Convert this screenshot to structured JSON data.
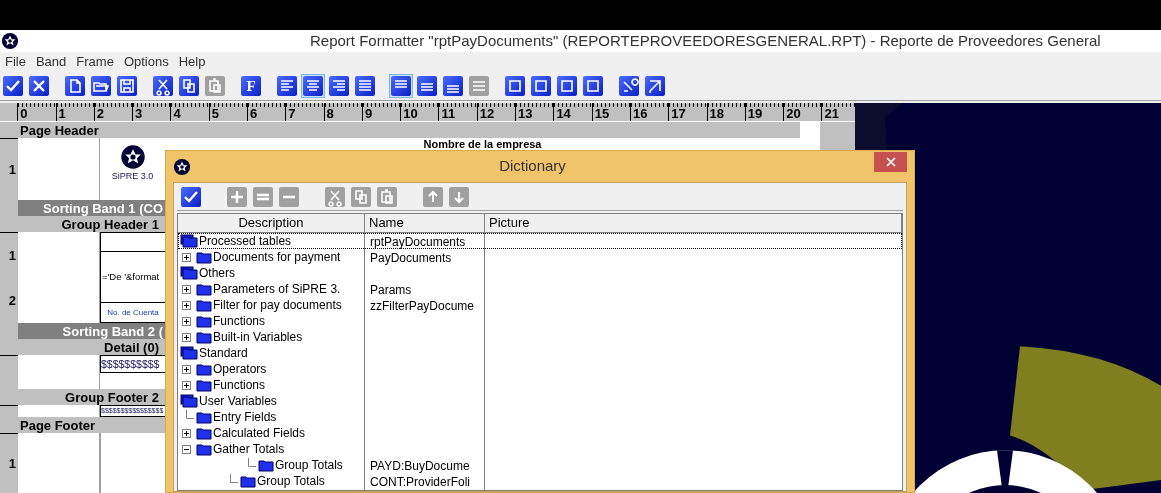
{
  "window": {
    "title": "Report Formatter \"rptPayDocuments\" (REPORTEPROVEEDORESGENERAL.RPT) - Reporte de Proveedores General"
  },
  "menu": [
    "File",
    "Band",
    "Frame",
    "Options",
    "Help"
  ],
  "toolbar": [
    [
      {
        "kind": "check",
        "pressed": false,
        "disabled": false
      },
      {
        "kind": "cross",
        "pressed": false,
        "disabled": false
      }
    ],
    [
      {
        "kind": "new",
        "pressed": false,
        "disabled": false
      },
      {
        "kind": "open",
        "pressed": false,
        "disabled": false
      },
      {
        "kind": "save",
        "pressed": false,
        "disabled": false
      }
    ],
    [
      {
        "kind": "cut",
        "pressed": false,
        "disabled": false
      },
      {
        "kind": "copy",
        "pressed": false,
        "disabled": false
      },
      {
        "kind": "paste",
        "pressed": false,
        "disabled": true
      }
    ],
    [
      {
        "kind": "font",
        "label": "F",
        "pressed": false,
        "disabled": false
      }
    ],
    [
      {
        "kind": "align-left",
        "pressed": false,
        "disabled": false
      },
      {
        "kind": "align-center",
        "pressed": true,
        "disabled": false
      },
      {
        "kind": "align-right",
        "pressed": false,
        "disabled": false
      },
      {
        "kind": "justify",
        "pressed": false,
        "disabled": false
      }
    ],
    [
      {
        "kind": "valign-top",
        "pressed": true,
        "disabled": false
      },
      {
        "kind": "valign-middle",
        "pressed": false,
        "disabled": false
      },
      {
        "kind": "valign-bottom",
        "pressed": false,
        "disabled": false
      },
      {
        "kind": "lines",
        "pressed": false,
        "disabled": true
      }
    ],
    [
      {
        "kind": "frame",
        "pressed": false,
        "disabled": false
      },
      {
        "kind": "frame",
        "pressed": false,
        "disabled": false
      },
      {
        "kind": "frame",
        "pressed": false,
        "disabled": false
      },
      {
        "kind": "frame",
        "pressed": false,
        "disabled": false
      }
    ],
    [
      {
        "kind": "brush",
        "pressed": false,
        "disabled": false
      },
      {
        "kind": "pen",
        "pressed": false,
        "disabled": false
      }
    ]
  ],
  "ruler": [
    "0",
    "1",
    "2",
    "3",
    "4",
    "5",
    "6",
    "7",
    "8",
    "9",
    "10",
    "11",
    "12",
    "13",
    "14",
    "15",
    "16",
    "17",
    "18",
    "19",
    "20",
    "21"
  ],
  "bands": [
    {
      "kind": "page",
      "label": "Page Header",
      "content": {
        "kind": "header",
        "ruler_marks": [
          "1"
        ],
        "logo_caption": "SiPRE 3.0",
        "company": "Nombre de la empresa"
      }
    },
    {
      "kind": "sorting",
      "label": "Sorting Band 1 (CO"
    },
    {
      "kind": "group",
      "label": "Group Header 1",
      "content": {
        "kind": "fields",
        "ruler_marks": [
          "1",
          "2"
        ],
        "cells": [
          "='De '&format",
          "No. de Cuenta"
        ]
      }
    },
    {
      "kind": "sorting",
      "label": "Sorting Band 2 ("
    },
    {
      "kind": "group",
      "label": "Detail (0)",
      "content": {
        "kind": "amount",
        "cells": [
          "$$$$$$$$$$"
        ]
      }
    },
    {
      "kind": "group",
      "label": "Group Footer 2",
      "content": {
        "kind": "total",
        "cells": [
          "$$$$$$$$$$$$$$$$"
        ]
      }
    },
    {
      "kind": "page",
      "label": "Page Footer",
      "content": {
        "kind": "empty",
        "ruler_marks": [
          "1"
        ]
      }
    }
  ],
  "dialog": {
    "title": "Dictionary",
    "toolbar": [
      [
        {
          "kind": "check",
          "disabled": false
        }
      ],
      [
        {
          "kind": "plus",
          "disabled": true
        },
        {
          "kind": "equals",
          "disabled": true
        },
        {
          "kind": "minus",
          "disabled": true
        }
      ],
      [
        {
          "kind": "cut",
          "disabled": true
        },
        {
          "kind": "copy",
          "disabled": true
        },
        {
          "kind": "paste",
          "disabled": true
        }
      ],
      [
        {
          "kind": "up",
          "disabled": true
        },
        {
          "kind": "down",
          "disabled": true
        }
      ]
    ],
    "columns": [
      "Description",
      "Name",
      "Picture"
    ],
    "tree": [
      {
        "kind": "database",
        "description": "Processed tables",
        "name": "rptPayDocuments",
        "selected": true,
        "children": [
          {
            "kind": "folder",
            "description": "Documents for payment",
            "name": "PayDocuments",
            "expanded": false
          }
        ]
      },
      {
        "kind": "database",
        "description": "Others",
        "selected": false,
        "children": [
          {
            "kind": "folder",
            "description": "Parameters of SiPRE 3.",
            "name": "Params",
            "expanded": false
          },
          {
            "kind": "folder",
            "description": "Filter for pay documents",
            "name": "zzFilterPayDocume",
            "expanded": false
          },
          {
            "kind": "folder",
            "description": "Functions",
            "expanded": false
          },
          {
            "kind": "folder",
            "description": "Built-in Variables",
            "expanded": false
          }
        ]
      },
      {
        "kind": "database",
        "description": "Standard",
        "selected": false,
        "children": [
          {
            "kind": "folder",
            "description": "Operators",
            "expanded": false
          },
          {
            "kind": "folder",
            "description": "Functions",
            "expanded": false
          }
        ]
      },
      {
        "kind": "database",
        "description": "User Variables",
        "selected": false,
        "children": [
          {
            "kind": "leaf",
            "description": "Entry Fields"
          },
          {
            "kind": "folder",
            "description": "Calculated Fields",
            "expanded": false
          },
          {
            "kind": "folder",
            "description": "Gather Totals",
            "expanded": true,
            "children": [
              {
                "kind": "subleaf",
                "description": "Group Totals",
                "name": "PAYD:BuyDocume"
              },
              {
                "kind": "leaf",
                "description": "Group Totals",
                "name": "CONT:ProviderFoli"
              }
            ]
          }
        ]
      }
    ]
  }
}
